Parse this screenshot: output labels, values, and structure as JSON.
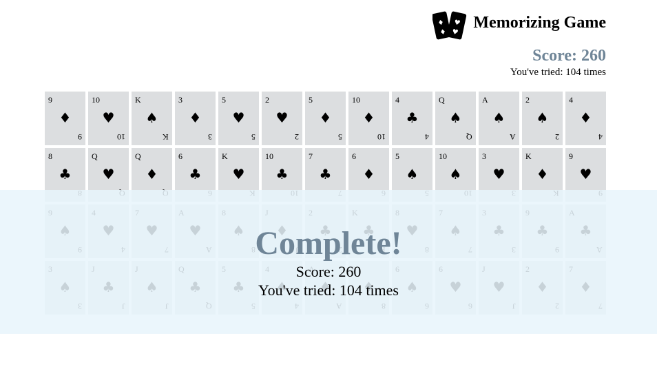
{
  "header": {
    "title": "Memorizing Game",
    "score": "Score: 260",
    "tries": "You've tried: 104 times"
  },
  "cards": [
    {
      "rank": "9",
      "suit": "♦"
    },
    {
      "rank": "10",
      "suit": "♥"
    },
    {
      "rank": "K",
      "suit": "♠"
    },
    {
      "rank": "3",
      "suit": "♦"
    },
    {
      "rank": "5",
      "suit": "♥"
    },
    {
      "rank": "2",
      "suit": "♥"
    },
    {
      "rank": "5",
      "suit": "♦"
    },
    {
      "rank": "10",
      "suit": "♦"
    },
    {
      "rank": "4",
      "suit": "♣"
    },
    {
      "rank": "Q",
      "suit": "♠"
    },
    {
      "rank": "A",
      "suit": "♠"
    },
    {
      "rank": "2",
      "suit": "♠"
    },
    {
      "rank": "4",
      "suit": "♦"
    },
    {
      "rank": "8",
      "suit": "♣"
    },
    {
      "rank": "Q",
      "suit": "♥"
    },
    {
      "rank": "Q",
      "suit": "♦"
    },
    {
      "rank": "6",
      "suit": "♣"
    },
    {
      "rank": "K",
      "suit": "♥"
    },
    {
      "rank": "10",
      "suit": "♣"
    },
    {
      "rank": "7",
      "suit": "♣"
    },
    {
      "rank": "6",
      "suit": "♦"
    },
    {
      "rank": "5",
      "suit": "♠"
    },
    {
      "rank": "10",
      "suit": "♠"
    },
    {
      "rank": "3",
      "suit": "♥"
    },
    {
      "rank": "K",
      "suit": "♦"
    },
    {
      "rank": "9",
      "suit": "♥"
    },
    {
      "rank": "9",
      "suit": "♠"
    },
    {
      "rank": "4",
      "suit": "♥"
    },
    {
      "rank": "7",
      "suit": "♥"
    },
    {
      "rank": "A",
      "suit": "♥"
    },
    {
      "rank": "8",
      "suit": "♠"
    },
    {
      "rank": "J",
      "suit": "♦"
    },
    {
      "rank": "2",
      "suit": "♣"
    },
    {
      "rank": "K",
      "suit": "♣"
    },
    {
      "rank": "8",
      "suit": "♥"
    },
    {
      "rank": "7",
      "suit": "♠"
    },
    {
      "rank": "3",
      "suit": "♣"
    },
    {
      "rank": "9",
      "suit": "♣"
    },
    {
      "rank": "A",
      "suit": "♣"
    },
    {
      "rank": "3",
      "suit": "♠"
    },
    {
      "rank": "J",
      "suit": "♣"
    },
    {
      "rank": "J",
      "suit": "♠"
    },
    {
      "rank": "Q",
      "suit": "♣"
    },
    {
      "rank": "5",
      "suit": "♣"
    },
    {
      "rank": "4",
      "suit": "♠"
    },
    {
      "rank": "A",
      "suit": "♦"
    },
    {
      "rank": "8",
      "suit": "♦"
    },
    {
      "rank": "6",
      "suit": "♠"
    },
    {
      "rank": "6",
      "suit": "♥"
    },
    {
      "rank": "J",
      "suit": "♥"
    },
    {
      "rank": "2",
      "suit": "♦"
    },
    {
      "rank": "7",
      "suit": "♦"
    }
  ],
  "complete": {
    "title": "Complete!",
    "score": "Score: 260",
    "tries": "You've tried: 104 times"
  },
  "colors": {
    "accent": "#6f8597",
    "card_face": "#dcdee0",
    "overlay": "#e8f4fc"
  }
}
